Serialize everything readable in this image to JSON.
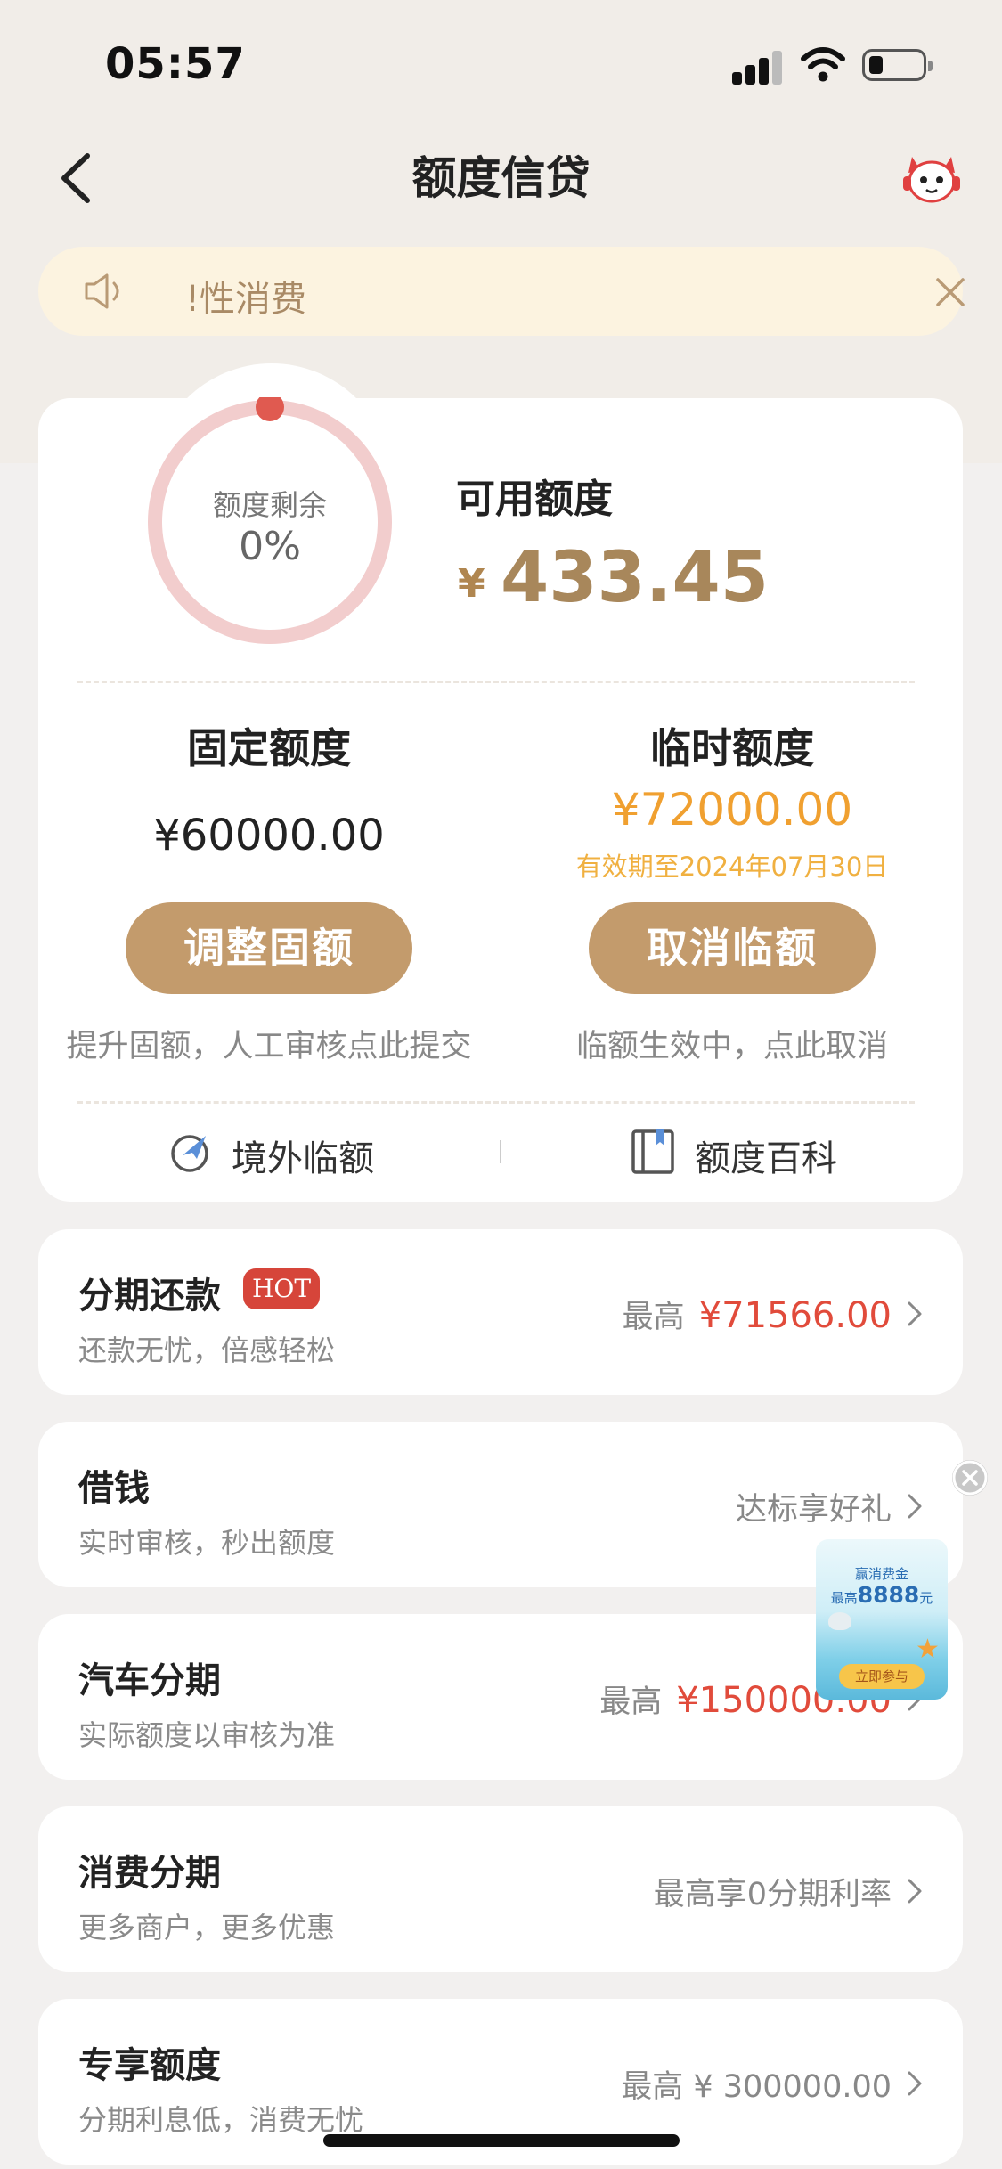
{
  "status_bar": {
    "time": "05:57"
  },
  "nav": {
    "title": "额度信贷"
  },
  "notice": {
    "text": "!性消费"
  },
  "credit_ring": {
    "label": "额度剩余",
    "value": "0%",
    "remaining_fraction": 0
  },
  "available": {
    "label": "可用额度",
    "currency": "¥",
    "amount": "433.45"
  },
  "fixed": {
    "title": "固定额度",
    "amount": "¥60000.00",
    "button": "调整固额",
    "hint": "提升固额，人工审核点此提交"
  },
  "temporary": {
    "title": "临时额度",
    "amount": "¥72000.00",
    "validity": "有效期至2024年07月30日",
    "button": "取消临额",
    "hint": "临额生效中，点此取消"
  },
  "links": {
    "overseas": "境外临额",
    "wiki": "额度百科"
  },
  "rows": [
    {
      "title": "分期还款",
      "badge": "HOT",
      "subtitle": "还款无忧，倍感轻松",
      "right_label": "最高",
      "right_value": "¥71566.00"
    },
    {
      "title": "借钱",
      "subtitle": "实时审核，秒出额度",
      "right_label": "达标享好礼"
    },
    {
      "title": "汽车分期",
      "subtitle": "实际额度以审核为准",
      "right_label": "最高",
      "right_value": "¥150000.00"
    },
    {
      "title": "消费分期",
      "subtitle": "更多商户，更多优惠",
      "right_label": "最高享0分期利率"
    },
    {
      "title": "专享额度",
      "subtitle": "分期利息低，消费无忧",
      "right_label": "最高 ¥ 300000.00"
    }
  ],
  "floating_ad": {
    "line1": "赢消费金",
    "line2_prefix": "最高",
    "line2_amount": "8888",
    "line2_suffix": "元",
    "button": "立即参与"
  },
  "colors": {
    "accent_gold": "#c39b6c",
    "amount_gold": "#a8875b",
    "temp_orange": "#f0a030",
    "hot_red": "#d6453a",
    "price_red": "#e14b3b"
  }
}
